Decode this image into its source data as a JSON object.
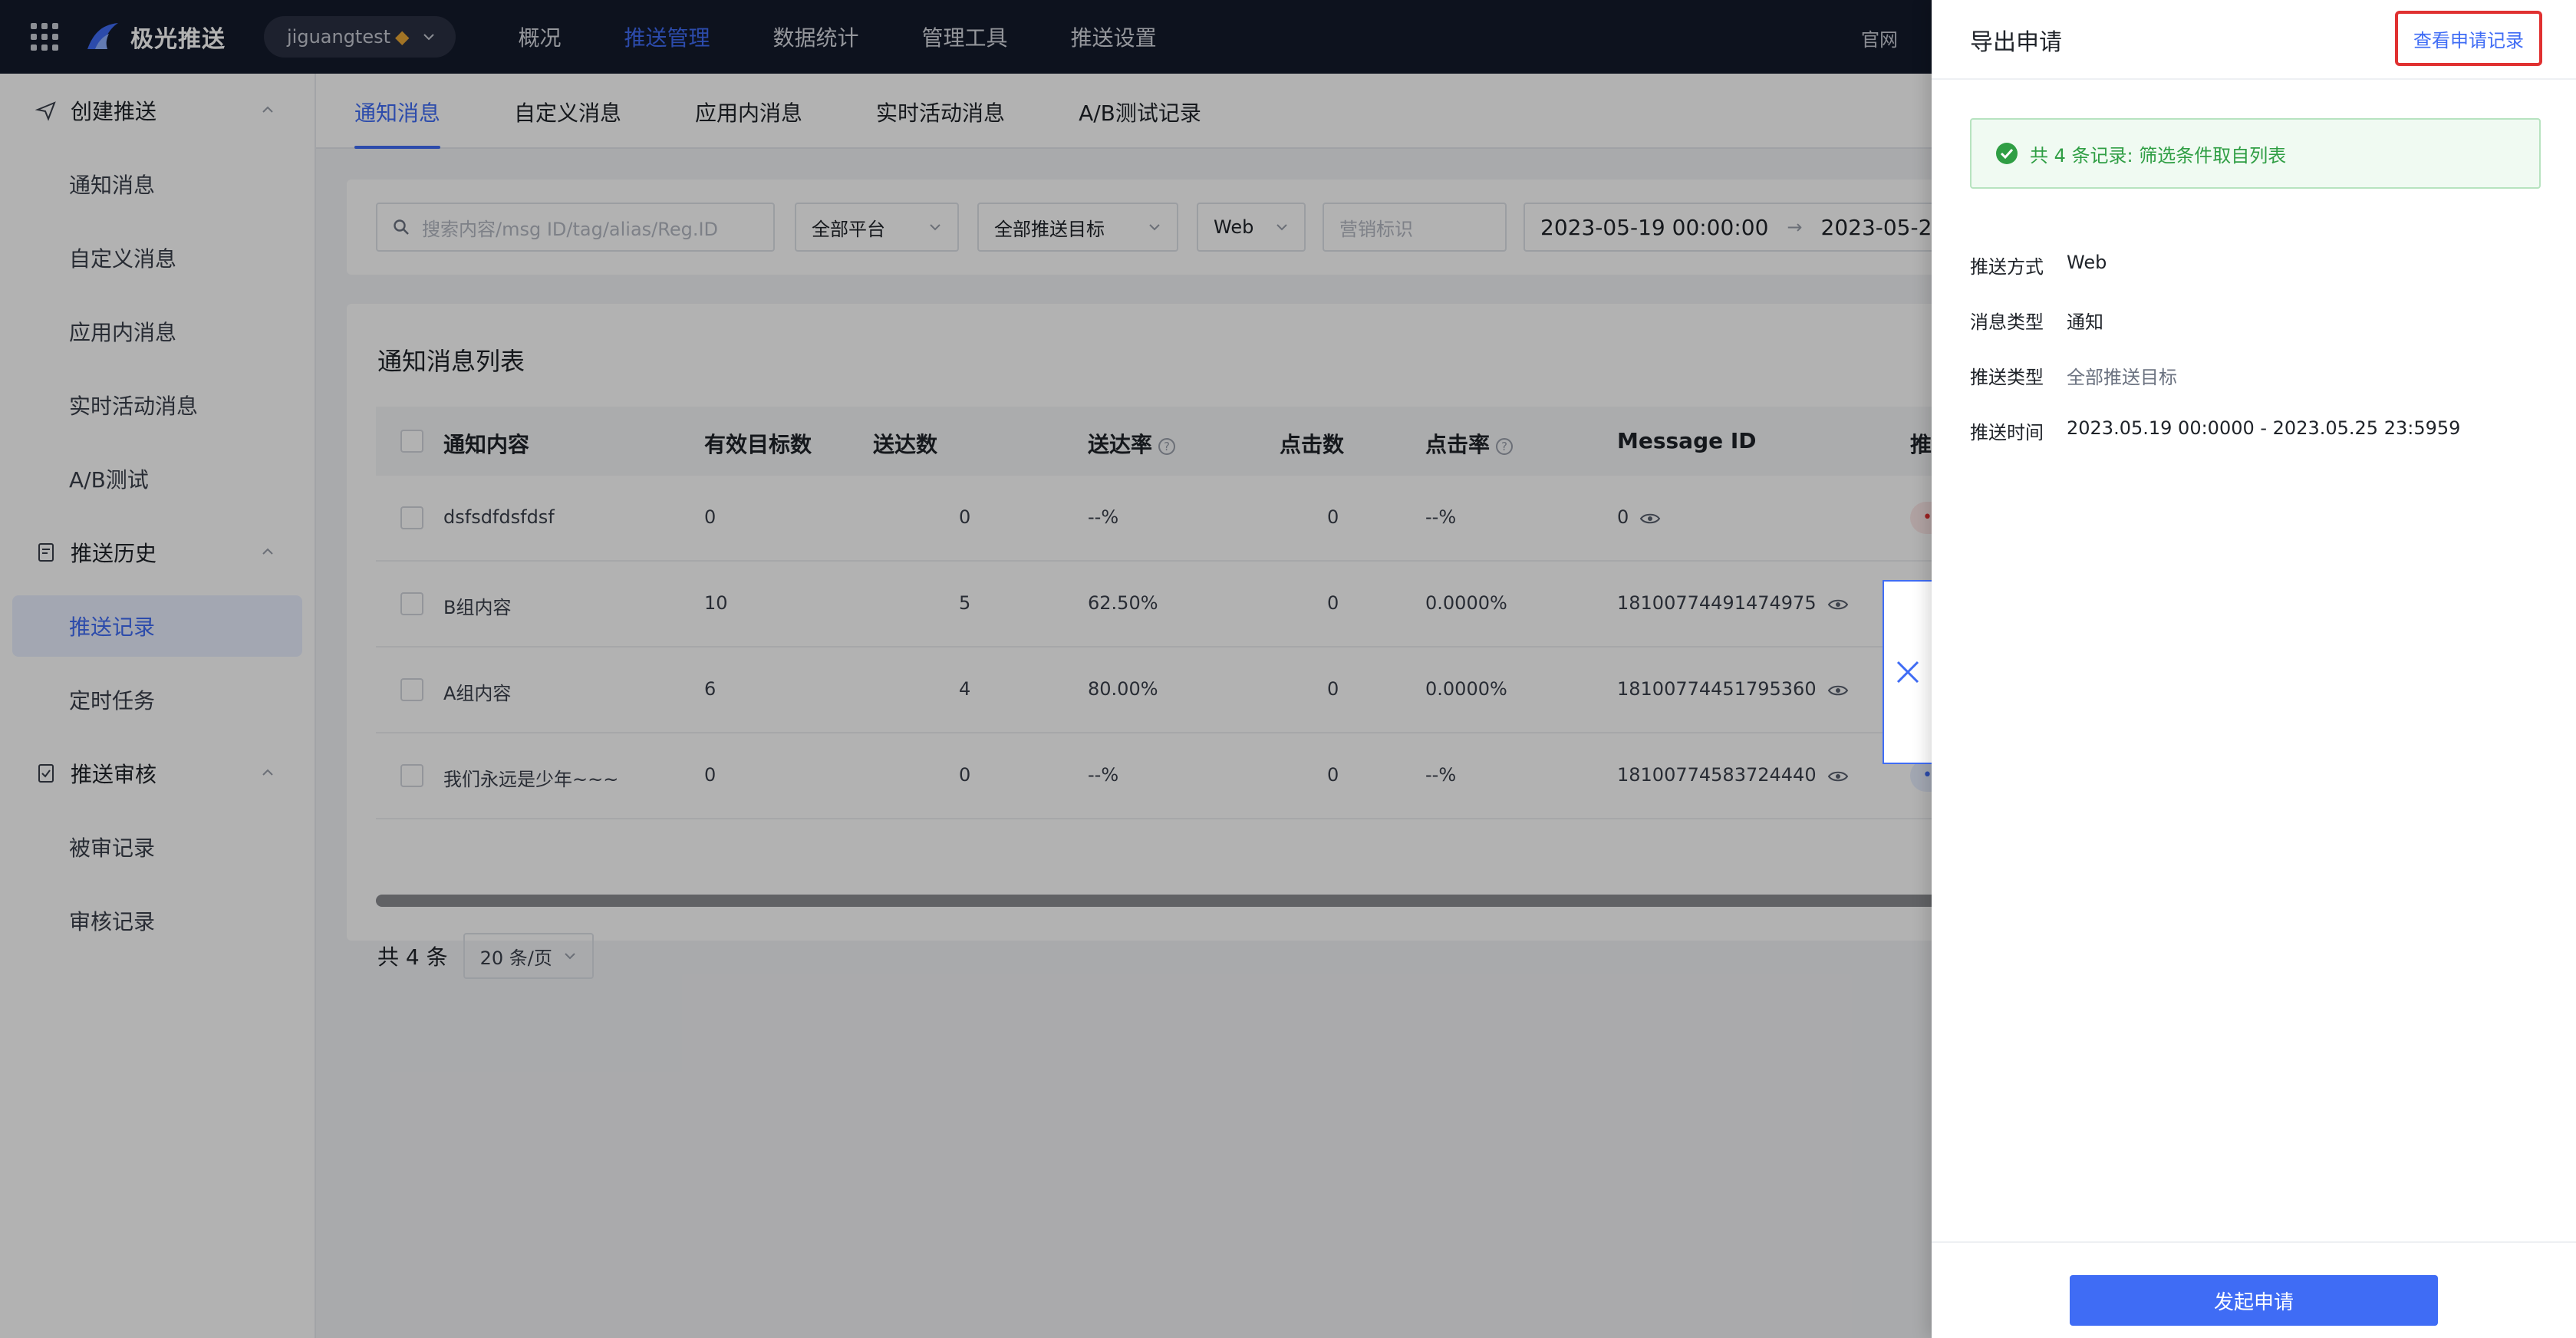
{
  "brand": {
    "name": "极光推送"
  },
  "header": {
    "account": "jiguangtest",
    "nav": [
      "概况",
      "推送管理",
      "数据统计",
      "管理工具",
      "推送设置"
    ],
    "active_nav": 1,
    "official_link": "官网"
  },
  "sidebar": {
    "groups": [
      {
        "label": "创建推送",
        "items": [
          "通知消息",
          "自定义消息",
          "应用内消息",
          "实时活动消息",
          "A/B测试"
        ]
      },
      {
        "label": "推送历史",
        "items": [
          "推送记录",
          "定时任务"
        ]
      },
      {
        "label": "推送审核",
        "items": [
          "被审记录",
          "审核记录"
        ]
      }
    ],
    "active_item": "推送记录"
  },
  "tabs": [
    "通知消息",
    "自定义消息",
    "应用内消息",
    "实时活动消息",
    "A/B测试记录"
  ],
  "filters": {
    "search_placeholder": "搜索内容/msg ID/tag/alias/Reg.ID",
    "platform": "全部平台",
    "target": "全部推送目标",
    "method": "Web",
    "marketing_placeholder": "营销标识",
    "date_start": "2023-05-19 00:00:00",
    "date_end": "2023-05-2",
    "range_arrow": "→"
  },
  "list": {
    "title": "通知消息列表",
    "columns": [
      "通知内容",
      "有效目标数",
      "送达数",
      "送达率",
      "点击数",
      "点击率",
      "Message ID",
      "推送状"
    ],
    "rows": [
      {
        "content": "dsfsdfdsfdsf",
        "targets": "0",
        "delivered": "0",
        "delivery_rate": "--%",
        "clicks": "0",
        "click_rate": "--%",
        "msg_id": "0",
        "status": "• 推送"
      },
      {
        "content": "B组内容",
        "targets": "10",
        "delivered": "5",
        "delivery_rate": "62.50%",
        "clicks": "0",
        "click_rate": "0.0000%",
        "msg_id": "18100774491474975",
        "status": ""
      },
      {
        "content": "A组内容",
        "targets": "6",
        "delivered": "4",
        "delivery_rate": "80.00%",
        "clicks": "0",
        "click_rate": "0.0000%",
        "msg_id": "18100774451795360",
        "status": ""
      },
      {
        "content": "我们永远是少年~~~",
        "targets": "0",
        "delivered": "0",
        "delivery_rate": "--%",
        "clicks": "0",
        "click_rate": "--%",
        "msg_id": "18100774583724440",
        "status": "• 已"
      }
    ],
    "total": "共 4 条",
    "page_size": "20 条/页"
  },
  "drawer": {
    "title": "导出申请",
    "view_records": "查看申请记录",
    "success_msg": "共 4 条记录: 筛选条件取自列表",
    "fields": [
      {
        "k": "推送方式",
        "v": "Web"
      },
      {
        "k": "消息类型",
        "v": "通知"
      },
      {
        "k": "推送类型",
        "v": "全部推送目标"
      },
      {
        "k": "推送时间",
        "v": "2023.05.19 00:0000 - 2023.05.25 23:5959"
      }
    ],
    "submit": "发起申请"
  },
  "colors": {
    "accent": "#3f6cf5",
    "header_bg": "#141a2b",
    "success": "#2f9e44",
    "highlight_border": "#e03131"
  }
}
